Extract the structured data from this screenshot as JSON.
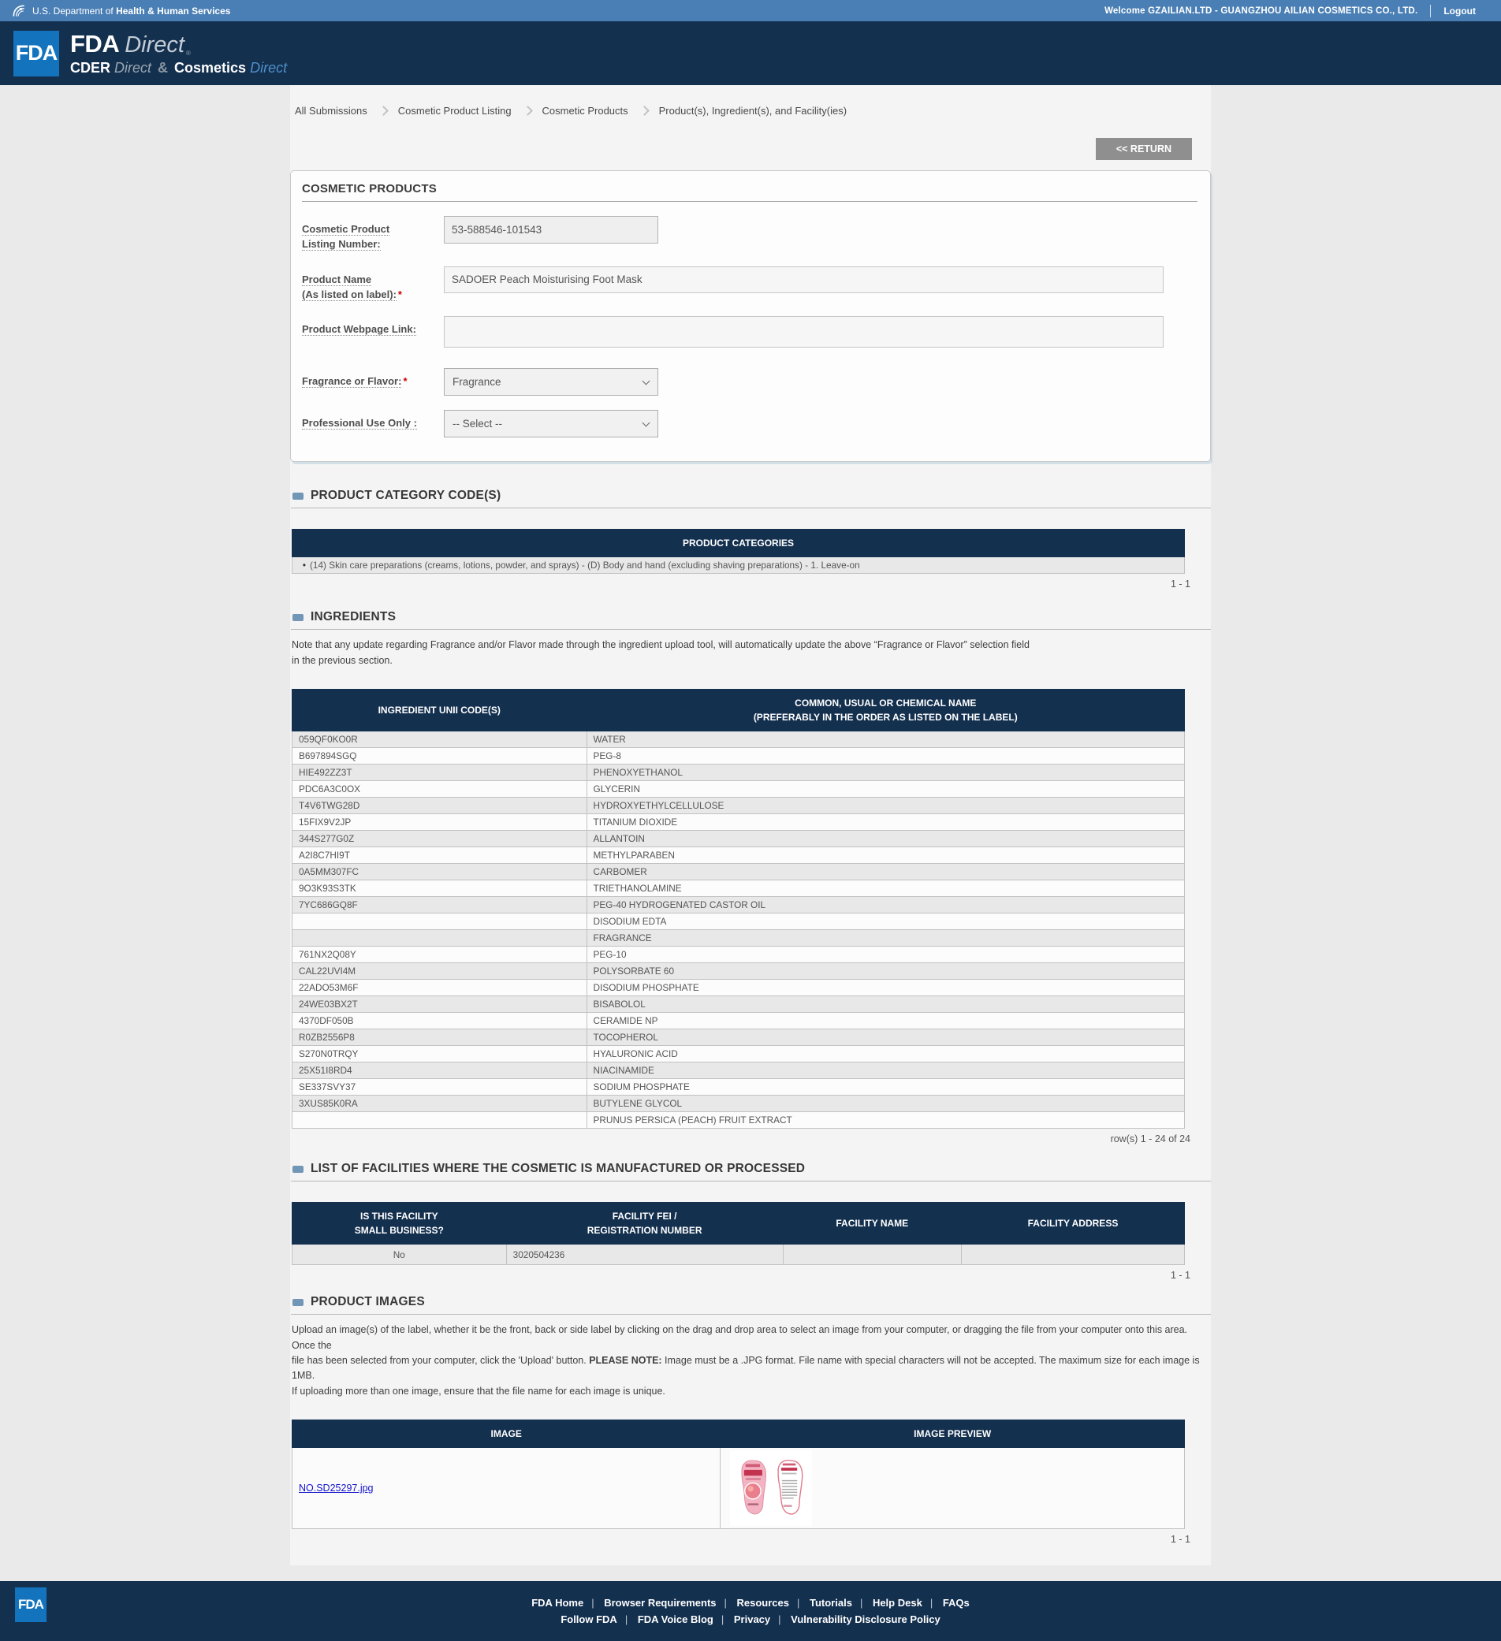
{
  "topbar": {
    "dept_prefix": "U.S. Department of",
    "dept_bold": "Health & Human Services",
    "welcome": "Welcome GZAILIAN.LTD - GUANGZHOU AILIAN COSMETICS CO., LTD.",
    "logout": "Logout"
  },
  "header": {
    "logo_text": "FDA",
    "brand_main": "FDA",
    "brand_direct": "Direct",
    "reg_mark": "®",
    "sub_cder": "CDER",
    "sub_direct1": "Direct",
    "sub_amp": "&",
    "sub_cosmetics": "Cosmetics",
    "sub_direct2": "Direct"
  },
  "breadcrumbs": [
    "All Submissions",
    "Cosmetic Product Listing",
    "Cosmetic Products",
    "Product(s), Ingredient(s), and Facility(ies)"
  ],
  "return_button": "<< RETURN",
  "product_form": {
    "title": "COSMETIC PRODUCTS",
    "asterisk": "*",
    "listing_number": {
      "label_line1": "Cosmetic Product",
      "label_line2": "Listing Number:",
      "value": "53-588546-101543"
    },
    "product_name": {
      "label_line1": "Product Name",
      "label_line2": "(As listed on label):",
      "value": "SADOER Peach Moisturising Foot Mask"
    },
    "webpage_link": {
      "label": "Product Webpage Link:",
      "value": ""
    },
    "fragrance_flavor": {
      "label": "Fragrance or Flavor:",
      "value": "Fragrance"
    },
    "professional_use": {
      "label": "Professional Use Only :",
      "value": "-- Select --"
    }
  },
  "category_section": {
    "title": "PRODUCT CATEGORY CODE(S)",
    "table_header": "PRODUCT CATEGORIES",
    "rows": [
      "(14) Skin care preparations (creams, lotions, powder, and sprays) - (D) Body and hand (excluding shaving preparations) - 1. Leave-on"
    ],
    "pagination": "1 - 1"
  },
  "ingredients_section": {
    "title": "INGREDIENTS",
    "note": "Note that any update regarding Fragrance and/or Flavor made through the ingredient upload tool, will automatically update the above “Fragrance or Flavor” selection field\nin the previous section.",
    "col1_header": "INGREDIENT UNII CODE(S)",
    "col2_header": "COMMON, USUAL OR CHEMICAL NAME\n(PREFERABLY IN THE ORDER AS LISTED ON THE LABEL)",
    "rows": [
      {
        "code": "059QF0KO0R",
        "name": "WATER"
      },
      {
        "code": "B697894SGQ",
        "name": "PEG-8"
      },
      {
        "code": "HIE492ZZ3T",
        "name": "PHENOXYETHANOL"
      },
      {
        "code": "PDC6A3C0OX",
        "name": "GLYCERIN"
      },
      {
        "code": "T4V6TWG28D",
        "name": "HYDROXYETHYLCELLULOSE"
      },
      {
        "code": "15FIX9V2JP",
        "name": "TITANIUM DIOXIDE"
      },
      {
        "code": "344S277G0Z",
        "name": "ALLANTOIN"
      },
      {
        "code": "A2I8C7HI9T",
        "name": "METHYLPARABEN"
      },
      {
        "code": "0A5MM307FC",
        "name": "CARBOMER"
      },
      {
        "code": "9O3K93S3TK",
        "name": "TRIETHANOLAMINE"
      },
      {
        "code": "7YC686GQ8F",
        "name": "PEG-40 HYDROGENATED CASTOR OIL"
      },
      {
        "code": "",
        "name": "DISODIUM EDTA"
      },
      {
        "code": "",
        "name": "FRAGRANCE"
      },
      {
        "code": "761NX2Q08Y",
        "name": "PEG-10"
      },
      {
        "code": "CAL22UVI4M",
        "name": "POLYSORBATE 60"
      },
      {
        "code": "22ADO53M6F",
        "name": "DISODIUM PHOSPHATE"
      },
      {
        "code": "24WE03BX2T",
        "name": "BISABOLOL"
      },
      {
        "code": "4370DF050B",
        "name": "CERAMIDE NP"
      },
      {
        "code": "R0ZB2556P8",
        "name": "TOCOPHEROL"
      },
      {
        "code": "S270N0TRQY",
        "name": "HYALURONIC ACID"
      },
      {
        "code": "25X51I8RD4",
        "name": "NIACINAMIDE"
      },
      {
        "code": "SE337SVY37",
        "name": "SODIUM PHOSPHATE"
      },
      {
        "code": "3XUS85K0RA",
        "name": "BUTYLENE GLYCOL"
      },
      {
        "code": "",
        "name": "PRUNUS PERSICA (PEACH) FRUIT EXTRACT"
      }
    ],
    "pagination": "row(s) 1 - 24 of 24"
  },
  "facilities_section": {
    "title": "LIST OF FACILITIES WHERE THE COSMETIC IS MANUFACTURED OR PROCESSED",
    "headers": {
      "small_business": "IS THIS FACILITY\nSMALL BUSINESS?",
      "fei": "FACILITY FEI /\nREGISTRATION NUMBER",
      "name": "FACILITY NAME",
      "address": "FACILITY ADDRESS"
    },
    "row": {
      "small_business": "No",
      "fei": "3020504236",
      "name": "",
      "address": ""
    },
    "pagination": "1 - 1"
  },
  "images_section": {
    "title": "PRODUCT IMAGES",
    "instructions_pre": "Upload an image(s) of the label, whether it be the front, back or side label by clicking on the drag and drop area to select an image from your computer, or dragging the file from your computer onto this area. Once the\nfile has been selected from your computer, click the 'Upload' button. ",
    "instructions_bold": "PLEASE NOTE:",
    "instructions_post": " Image must be a .JPG format. File name with special characters will not be accepted. The maximum size for each image is 1MB.\nIf uploading more than one image, ensure that the file name for each image is unique.",
    "col1_header": "IMAGE",
    "col2_header": "IMAGE PREVIEW",
    "file_name": "NO.SD25297.jpg",
    "pagination": "1 - 1"
  },
  "footer": {
    "logo_text": "FDA",
    "links_row1": [
      "FDA Home",
      "Browser Requirements",
      "Resources",
      "Tutorials",
      "Help Desk",
      "FAQs"
    ],
    "links_row2": [
      "Follow FDA",
      "FDA Voice Blog",
      "Privacy",
      "Vulnerability Disclosure Policy"
    ]
  },
  "colors": {
    "topbar_blue": "#4a7fb5",
    "navy": "#14304f",
    "fda_logo_blue": "#1374bd",
    "row_stripe_gray": "#e8e8e8",
    "link_blue": "#1414cc",
    "required_red": "#cc0000"
  }
}
